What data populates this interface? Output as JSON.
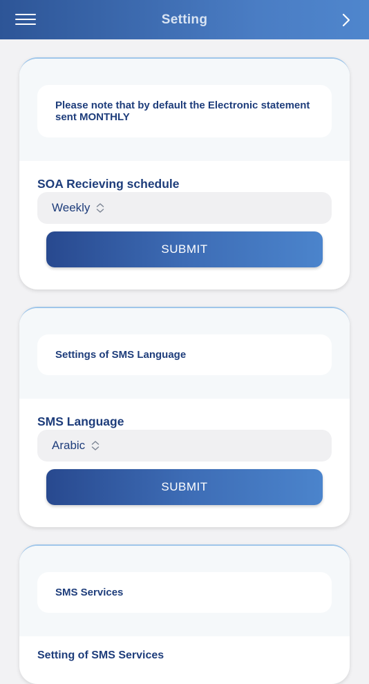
{
  "header": {
    "title": "Setting",
    "menu_icon": "hamburger-menu-icon",
    "next_icon": "chevron-right-icon"
  },
  "cards": [
    {
      "note": "Please note that by default the Electronic statement sent MONTHLY",
      "label": "SOA Recieving schedule",
      "selected": "Weekly",
      "button": "SUBMIT"
    },
    {
      "note": "Settings of SMS Language",
      "label": "SMS Language",
      "selected": "Arabic",
      "button": "SUBMIT"
    },
    {
      "note": "SMS Services",
      "label": "Setting of SMS Services"
    }
  ],
  "colors": {
    "primary": "#2d5597",
    "text": "#1e3d7b",
    "background": "#f2f2f4"
  }
}
